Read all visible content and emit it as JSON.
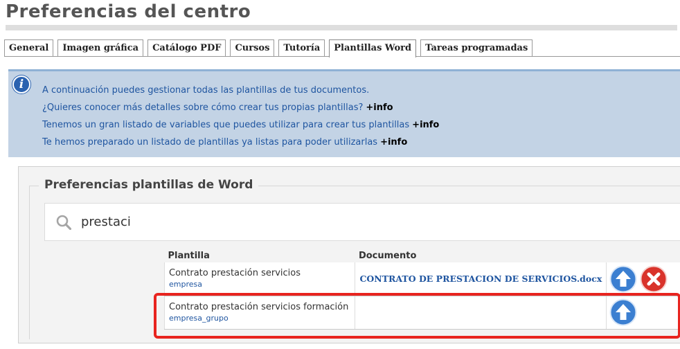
{
  "page": {
    "title": "Preferencias del centro"
  },
  "tabs": [
    {
      "label": "General"
    },
    {
      "label": "Imagen gráfica"
    },
    {
      "label": "Catálogo PDF"
    },
    {
      "label": "Cursos"
    },
    {
      "label": "Tutoría"
    },
    {
      "label": "Plantillas Word",
      "active": true
    },
    {
      "label": "Tareas programadas"
    }
  ],
  "info": {
    "icon": "info-icon",
    "lines": [
      {
        "text": "A continuación puedes gestionar todas las plantillas de tus documentos.",
        "more": ""
      },
      {
        "text": "¿Quieres conocer más detalles sobre cómo crear tus propias plantillas?",
        "more": "+info"
      },
      {
        "text": "Tenemos un gran listado de variables que puedes utilizar para crear tus plantillas",
        "more": "+info"
      },
      {
        "text": "Te hemos preparado un listado de plantillas ya listas para poder utilizarlas",
        "more": "+info"
      }
    ]
  },
  "section": {
    "legend": "Preferencias plantillas de Word"
  },
  "search": {
    "value": "prestaci",
    "icon": "search-icon"
  },
  "table": {
    "headers": {
      "plantilla": "Plantilla",
      "documento": "Documento"
    },
    "rows": [
      {
        "name": "Contrato prestación servicios",
        "scope": "empresa",
        "document": "CONTRATO DE PRESTACION DE SERVICIOS.docx",
        "actions": [
          "upload-icon",
          "delete-icon"
        ]
      },
      {
        "name": "Contrato prestación servicios formación",
        "scope": "empresa_grupo",
        "document": "",
        "actions": [
          "upload-icon"
        ]
      }
    ]
  },
  "colors": {
    "accent_blue": "#1f55a0",
    "info_bg": "#c3d3e5",
    "upload_blue": "#3b7fd1",
    "delete_red": "#d9332b",
    "highlight_red": "#e8241f"
  }
}
